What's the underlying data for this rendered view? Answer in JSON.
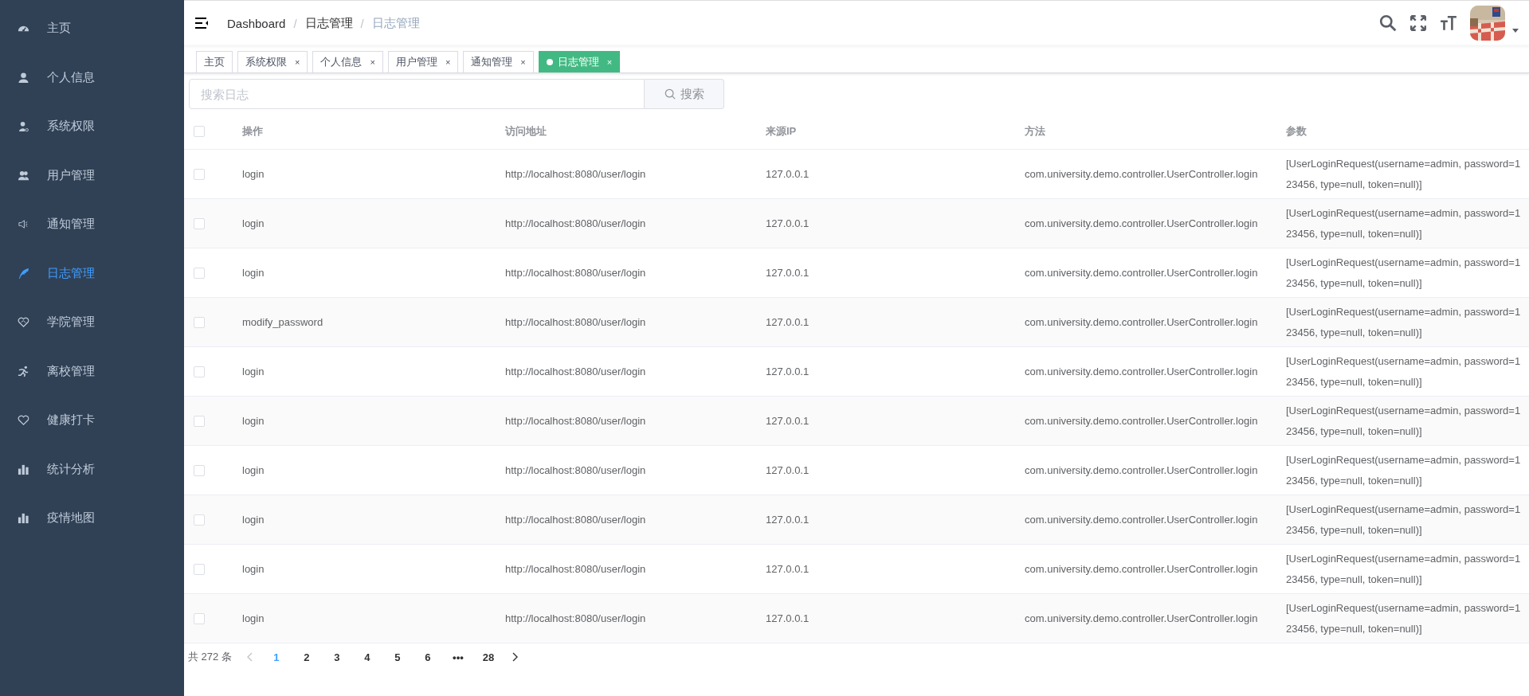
{
  "sidebar": {
    "items": [
      {
        "label": "主页",
        "selected": false
      },
      {
        "label": "个人信息",
        "selected": false
      },
      {
        "label": "系统权限",
        "selected": false
      },
      {
        "label": "用户管理",
        "selected": false
      },
      {
        "label": "通知管理",
        "selected": false
      },
      {
        "label": "日志管理",
        "selected": true
      },
      {
        "label": "学院管理",
        "selected": false
      },
      {
        "label": "离校管理",
        "selected": false
      },
      {
        "label": "健康打卡",
        "selected": false
      },
      {
        "label": "统计分析",
        "selected": false
      },
      {
        "label": "疫情地图",
        "selected": false
      }
    ]
  },
  "breadcrumb": {
    "separator": "/",
    "items": [
      "Dashboard",
      "日志管理",
      "日志管理"
    ]
  },
  "tags": [
    {
      "label": "主页",
      "selected": false
    },
    {
      "label": "系统权限",
      "close": "×",
      "selected": false
    },
    {
      "label": "个人信息",
      "close": "×",
      "selected": false
    },
    {
      "label": "用户管理",
      "close": "×",
      "selected": false
    },
    {
      "label": "通知管理",
      "close": "×",
      "selected": false
    },
    {
      "label": "日志管理",
      "close": "×",
      "selected": true
    }
  ],
  "search": {
    "placeholder": "搜索日志",
    "button": "搜索"
  },
  "table": {
    "select_all": {
      "checked": false
    },
    "columns": [
      "操作",
      "访问地址",
      "来源IP",
      "方法",
      "参数"
    ],
    "rows": [
      {
        "checked": false,
        "cells": [
          "login",
          "http://localhost:8080/user/login",
          "127.0.0.1",
          "com.university.demo.controller.UserController.login",
          "[UserLoginRequest(username=admin, password=123456, type=null, token=null)]"
        ]
      },
      {
        "checked": false,
        "cells": [
          "login",
          "http://localhost:8080/user/login",
          "127.0.0.1",
          "com.university.demo.controller.UserController.login",
          "[UserLoginRequest(username=admin, password=123456, type=null, token=null)]"
        ]
      },
      {
        "checked": false,
        "cells": [
          "login",
          "http://localhost:8080/user/login",
          "127.0.0.1",
          "com.university.demo.controller.UserController.login",
          "[UserLoginRequest(username=admin, password=123456, type=null, token=null)]"
        ]
      },
      {
        "checked": false,
        "cells": [
          "modify_password",
          "http://localhost:8080/user/login",
          "127.0.0.1",
          "com.university.demo.controller.UserController.login",
          "[UserLoginRequest(username=admin, password=123456, type=null, token=null)]"
        ]
      },
      {
        "checked": false,
        "cells": [
          "login",
          "http://localhost:8080/user/login",
          "127.0.0.1",
          "com.university.demo.controller.UserController.login",
          "[UserLoginRequest(username=admin, password=123456, type=null, token=null)]"
        ]
      },
      {
        "checked": false,
        "cells": [
          "login",
          "http://localhost:8080/user/login",
          "127.0.0.1",
          "com.university.demo.controller.UserController.login",
          "[UserLoginRequest(username=admin, password=123456, type=null, token=null)]"
        ]
      },
      {
        "checked": false,
        "cells": [
          "login",
          "http://localhost:8080/user/login",
          "127.0.0.1",
          "com.university.demo.controller.UserController.login",
          "[UserLoginRequest(username=admin, password=123456, type=null, token=null)]"
        ]
      },
      {
        "checked": false,
        "cells": [
          "login",
          "http://localhost:8080/user/login",
          "127.0.0.1",
          "com.university.demo.controller.UserController.login",
          "[UserLoginRequest(username=admin, password=123456, type=null, token=null)]"
        ]
      },
      {
        "checked": false,
        "cells": [
          "login",
          "http://localhost:8080/user/login",
          "127.0.0.1",
          "com.university.demo.controller.UserController.login",
          "[UserLoginRequest(username=admin, password=123456, type=null, token=null)]"
        ]
      },
      {
        "checked": false,
        "cells": [
          "login",
          "http://localhost:8080/user/login",
          "127.0.0.1",
          "com.university.demo.controller.UserController.login",
          "[UserLoginRequest(username=admin, password=123456, type=null, token=null)]"
        ]
      }
    ]
  },
  "pagination": {
    "total": "共 272 条",
    "pages": [
      {
        "label": "1",
        "selected": true
      },
      {
        "label": "2",
        "selected": false
      },
      {
        "label": "3",
        "selected": false
      },
      {
        "label": "4",
        "selected": false
      },
      {
        "label": "5",
        "selected": false
      },
      {
        "label": "6",
        "selected": false
      },
      {
        "label": "•••",
        "selected": false
      },
      {
        "label": "28",
        "selected": false
      }
    ]
  }
}
